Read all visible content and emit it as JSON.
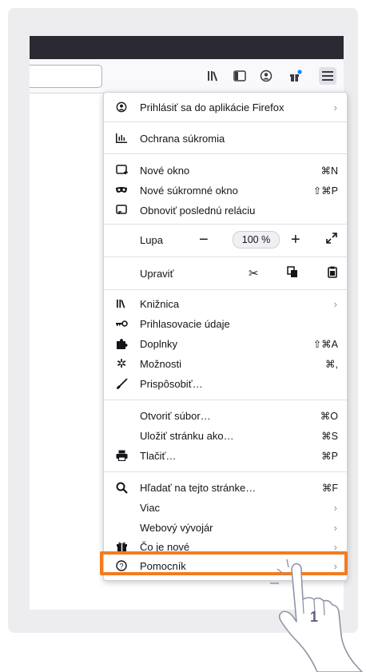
{
  "colors": {
    "highlight": "#f47b20",
    "titlebar": "#2b2a33",
    "frame": "#ededf0"
  },
  "toolbar": {
    "icons": [
      "library-icon",
      "sidebar-icon",
      "account-icon",
      "whats-new-gift-icon",
      "hamburger-menu-icon"
    ]
  },
  "menu": {
    "sign_in": "Prihlásiť sa do aplikácie Firefox",
    "privacy": "Ochrana súkromia",
    "new_window": {
      "label": "Nové okno",
      "shortcut": "⌘N"
    },
    "new_private": {
      "label": "Nové súkromné okno",
      "shortcut": "⇧⌘P"
    },
    "restore_session": "Obnoviť poslednú reláciu",
    "zoom": {
      "label": "Lupa",
      "minus": "−",
      "value": "100 %",
      "plus": "+"
    },
    "edit": {
      "label": "Upraviť"
    },
    "library": "Knižnica",
    "logins": "Prihlasovacie údaje",
    "addons": {
      "label": "Doplnky",
      "shortcut": "⇧⌘A"
    },
    "options": {
      "label": "Možnosti",
      "shortcut": "⌘,"
    },
    "customize": "Prispôsobiť…",
    "open_file": {
      "label": "Otvoriť súbor…",
      "shortcut": "⌘O"
    },
    "save_page": {
      "label": "Uložiť stránku ako…",
      "shortcut": "⌘S"
    },
    "print": {
      "label": "Tlačiť…",
      "shortcut": "⌘P"
    },
    "find": {
      "label": "Hľadať na tejto stránke…",
      "shortcut": "⌘F"
    },
    "more": "Viac",
    "web_developer": "Webový vývojár",
    "whats_new": "Čo je nové",
    "help": "Pomocník"
  },
  "step_number": "1"
}
